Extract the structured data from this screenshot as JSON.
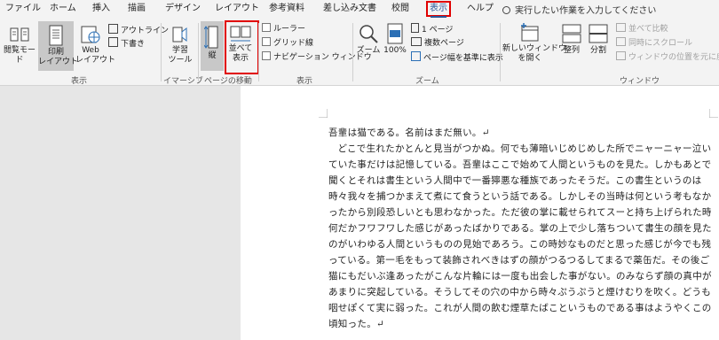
{
  "tabs": [
    "ファイル",
    "ホーム",
    "挿入",
    "描画",
    "デザイン",
    "レイアウト",
    "参考資料",
    "差し込み文書",
    "校閲",
    "表示",
    "ヘルプ"
  ],
  "tellme": "実行したい作業を入力してください",
  "ribbon": {
    "views": {
      "read": "閲覧モード",
      "print": "印刷\nレイアウト",
      "web": "Web\nレイアウト",
      "outline": "アウトライン",
      "draft": "下書き",
      "group": "表示"
    },
    "immersive": {
      "learn": "学習\nツール",
      "group": "イマーシブ"
    },
    "pagemove": {
      "vertical": "縦",
      "side": "並べて\n表示",
      "group": "ページの移動"
    },
    "show": {
      "ruler": "ルーラー",
      "grid": "グリッド線",
      "nav": "ナビゲーション ウィンドウ",
      "group": "表示"
    },
    "zoom": {
      "zoom": "ズーム",
      "percent": "100%",
      "one": "1 ページ",
      "multi": "複数ページ",
      "width": "ページ幅を基準に表示",
      "group": "ズーム"
    },
    "window": {
      "new": "新しいウィンドウ\nを開く",
      "arrange": "整列",
      "split": "分割",
      "side": "並べて比較",
      "sync": "同時にスクロール",
      "reset": "ウィンドウの位置を元に戻す",
      "group": "ウィンドウ"
    }
  },
  "document": {
    "p1": "吾輩は猫である。名前はまだ無い。↵",
    "p2": "どこで生れたかとんと見当がつかぬ。何でも薄暗いじめじめした所でニャーニャー泣いていた事だけは記憶している。吾輩はここで始めて人間というものを見た。しかもあとで聞くとそれは書生という人間中で一番獰悪な種族であったそうだ。この書生というのは時々我々を捕つかまえて煮にて食うという話である。しかしその当時は何という考もなかったから別段恐しいとも思わなかった。ただ彼の掌に載せられてスーと持ち上げられた時何だかフワフワした感じがあったばかりである。掌の上で少し落ちついて書生の顔を見たのがいわゆる人間というものの見始であろう。この時妙なものだと思った感じが今でも残っている。第一毛をもって装飾されべきはずの顔がつるつるしてまるで薬缶だ。その後ご猫にもだいぶ逢あったがこんな片輪には一度も出会した事がない。のみならず顔の真中があまりに突起している。そうしてその穴の中から時々ぷうぷうと煙けむりを吹く。どうも咽せぽくて実に弱った。これが人間の飲む煙草たばこというものである事はようやくこの頃知った。↵"
  }
}
